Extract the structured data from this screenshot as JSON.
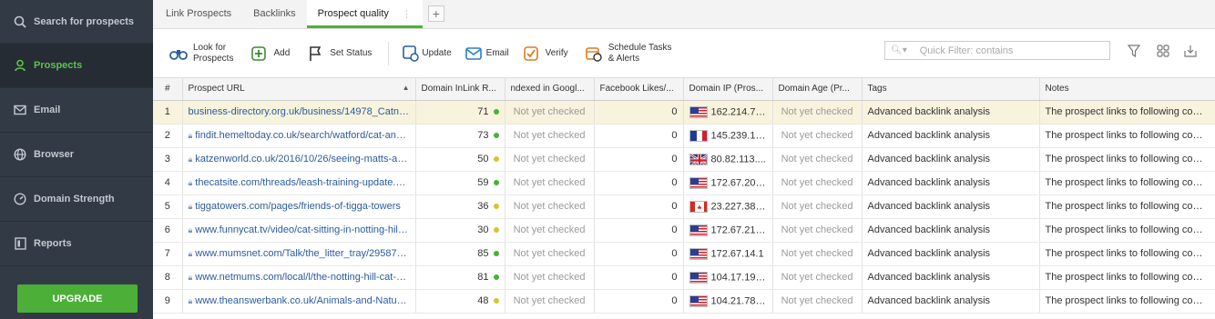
{
  "sidebar": {
    "items": [
      {
        "label": "Search for prospects",
        "icon": "search-icon"
      },
      {
        "label": "Prospects",
        "icon": "user-icon"
      },
      {
        "label": "Email",
        "icon": "envelope-icon"
      },
      {
        "label": "Browser",
        "icon": "globe-icon"
      },
      {
        "label": "Domain Strength",
        "icon": "gauge-icon"
      },
      {
        "label": "Reports",
        "icon": "report-icon"
      }
    ],
    "upgrade_label": "UPGRADE",
    "accent": "#5cc34b"
  },
  "tabs": [
    {
      "label": "Link Prospects"
    },
    {
      "label": "Backlinks"
    },
    {
      "label": "Prospect quality"
    }
  ],
  "toolbar": {
    "look_for_line1": "Look for",
    "look_for_line2": "Prospects",
    "add": "Add",
    "set_status": "Set Status",
    "update": "Update",
    "email": "Email",
    "verify": "Verify",
    "schedule_line1": "Schedule Tasks",
    "schedule_line2": "& Alerts",
    "filter_placeholder": "Quick Filter: contains"
  },
  "table": {
    "columns": [
      "#",
      "Prospect URL",
      "Domain InLink R...",
      "ndexed in Googl...",
      "Facebook Likes/...",
      "Domain IP (Pros...",
      "Domain Age (Pr...",
      "Tags",
      "Notes"
    ],
    "rows": [
      {
        "n": "1",
        "url": "business-directory.org.uk/business/14978_Catnips,-...",
        "lock": false,
        "rank": "71",
        "dot": "green",
        "indexed": "Not yet checked",
        "fb": "0",
        "flag": "us",
        "ip": "162.214.76...",
        "age": "Not yet checked",
        "tags": "Advanced backlink analysis",
        "notes": "The prospect links to following compet..."
      },
      {
        "n": "2",
        "url": "findit.hemeltoday.co.uk/search/watford/cat-and-do...",
        "lock": true,
        "rank": "73",
        "dot": "green",
        "indexed": "Not yet checked",
        "fb": "0",
        "flag": "fr",
        "ip": "145.239.17...",
        "age": "Not yet checked",
        "tags": "Advanced backlink analysis",
        "notes": "The prospect links to following compet..."
      },
      {
        "n": "3",
        "url": "katzenworld.co.uk/2016/10/26/seeing-matts-and-p...",
        "lock": true,
        "rank": "50",
        "dot": "yellow",
        "indexed": "Not yet checked",
        "fb": "0",
        "flag": "uk",
        "ip": "80.82.113....",
        "age": "Not yet checked",
        "tags": "Advanced backlink analysis",
        "notes": "The prospect links to following compet..."
      },
      {
        "n": "4",
        "url": "thecatsite.com/threads/leash-training-update.1779...",
        "lock": true,
        "rank": "59",
        "dot": "green",
        "indexed": "Not yet checked",
        "fb": "0",
        "flag": "us",
        "ip": "172.67.205...",
        "age": "Not yet checked",
        "tags": "Advanced backlink analysis",
        "notes": "The prospect links to following compet..."
      },
      {
        "n": "5",
        "url": "tiggatowers.com/pages/friends-of-tigga-towers",
        "lock": true,
        "rank": "36",
        "dot": "yellow",
        "indexed": "Not yet checked",
        "fb": "0",
        "flag": "ca",
        "ip": "23.227.38....",
        "age": "Not yet checked",
        "tags": "Advanced backlink analysis",
        "notes": "The prospect links to following compet..."
      },
      {
        "n": "6",
        "url": "www.funnycat.tv/video/cat-sitting-in-notting-hill-cat...",
        "lock": true,
        "rank": "30",
        "dot": "yellow",
        "indexed": "Not yet checked",
        "fb": "0",
        "flag": "us",
        "ip": "172.67.213...",
        "age": "Not yet checked",
        "tags": "Advanced backlink analysis",
        "notes": "The prospect links to following compet..."
      },
      {
        "n": "7",
        "url": "www.mumsnet.com/Talk/the_litter_tray/2958761-...",
        "lock": true,
        "rank": "85",
        "dot": "green",
        "indexed": "Not yet checked",
        "fb": "0",
        "flag": "us",
        "ip": "172.67.14.1",
        "age": "Not yet checked",
        "tags": "Advanced backlink analysis",
        "notes": "The prospect links to following compet..."
      },
      {
        "n": "8",
        "url": "www.netmums.com/local/l/the-notting-hill-cat-sittin...",
        "lock": true,
        "rank": "81",
        "dot": "green",
        "indexed": "Not yet checked",
        "fb": "0",
        "flag": "us",
        "ip": "104.17.193...",
        "age": "Not yet checked",
        "tags": "Advanced backlink analysis",
        "notes": "The prospect links to following compet..."
      },
      {
        "n": "9",
        "url": "www.theanswerbank.co.uk/Animals-and-Nature/...",
        "lock": true,
        "rank": "48",
        "dot": "yellow",
        "indexed": "Not yet checked",
        "fb": "0",
        "flag": "us",
        "ip": "104.21.78....",
        "age": "Not yet checked",
        "tags": "Advanced backlink analysis",
        "notes": "The prospect links to following compet..."
      }
    ]
  },
  "colors": {
    "green_dot": "#4caf38",
    "yellow_dot": "#d9c233",
    "selected_row": "#f7f3dd",
    "link": "#2b5b9e"
  }
}
